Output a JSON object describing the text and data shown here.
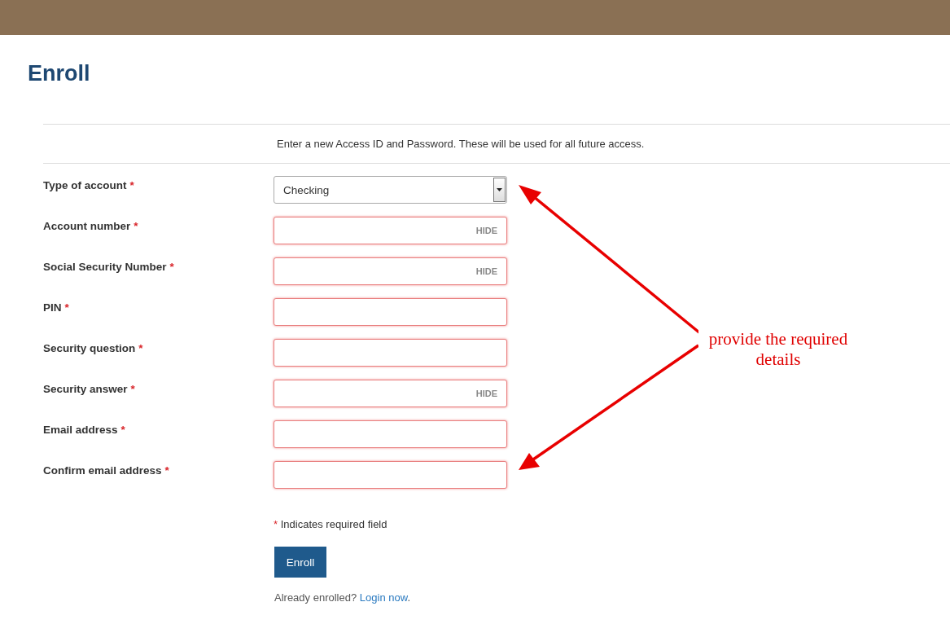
{
  "page": {
    "title": "Enroll"
  },
  "intro": "Enter a new Access ID and Password. These will be used for all future access.",
  "required_mark": "*",
  "fields": [
    {
      "label": "Type of account",
      "kind": "select",
      "value": "Checking",
      "required": true,
      "invalid": false
    },
    {
      "label": "Account number",
      "kind": "secret",
      "toggle": "HIDE",
      "required": true,
      "invalid": true
    },
    {
      "label": "Social Security Number",
      "kind": "secret",
      "toggle": "HIDE",
      "required": true,
      "invalid": true
    },
    {
      "label": "PIN",
      "kind": "text",
      "required": true,
      "invalid": true
    },
    {
      "label": "Security question",
      "kind": "text",
      "required": true,
      "invalid": true
    },
    {
      "label": "Security answer",
      "kind": "secret",
      "toggle": "HIDE",
      "required": true,
      "invalid": true
    },
    {
      "label": "Email address",
      "kind": "text",
      "required": true,
      "invalid": true
    },
    {
      "label": "Confirm email address",
      "kind": "text",
      "required": true,
      "invalid": true
    }
  ],
  "footnote": "Indicates required field",
  "submit": "Enroll",
  "login_prompt": {
    "text": "Already enrolled?",
    "link": "Login now",
    "after": "."
  },
  "annotation": "provide the required details"
}
